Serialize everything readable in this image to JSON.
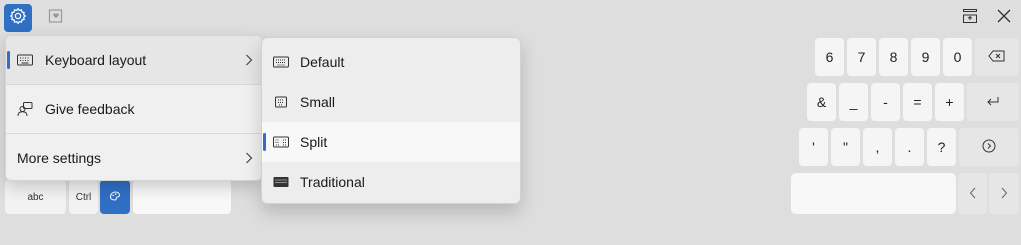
{
  "toolbar": {
    "settings_icon": "gear-icon",
    "favorites_icon": "heart-card-icon",
    "dock_icon": "dock-top-icon",
    "close_icon": "close-icon",
    "accent": "#2f6fc4"
  },
  "menu": {
    "items": [
      {
        "label": "Keyboard layout",
        "icon": "keyboard-icon",
        "has_submenu": true,
        "selected": true
      },
      {
        "label": "Give feedback",
        "icon": "feedback-person-icon",
        "has_submenu": false,
        "selected": false
      },
      {
        "label": "More settings",
        "icon": "",
        "has_submenu": true,
        "selected": false
      }
    ]
  },
  "submenu": {
    "items": [
      {
        "label": "Default",
        "icon": "keyboard-default-icon",
        "selected": false
      },
      {
        "label": "Small",
        "icon": "keyboard-small-icon",
        "selected": false
      },
      {
        "label": "Split",
        "icon": "keyboard-split-icon",
        "selected": true
      },
      {
        "label": "Traditional",
        "icon": "keyboard-traditional-icon",
        "selected": false
      }
    ]
  },
  "bottom_left": {
    "abc": "abc",
    "ctrl": "Ctrl",
    "emoji_icon": "emoji-palette-icon"
  },
  "keyboard": {
    "row1": [
      "6",
      "7",
      "8",
      "9",
      "0"
    ],
    "row2": [
      "&",
      "_",
      "-",
      "=",
      "+"
    ],
    "row3": [
      "'",
      "\"",
      ",",
      ".",
      "?"
    ],
    "backspace_icon": "backspace-icon",
    "enter_icon": "enter-icon",
    "next_icon": "circle-arrow-right-icon",
    "left_icon": "chevron-left-icon",
    "right_icon": "chevron-right-icon"
  }
}
